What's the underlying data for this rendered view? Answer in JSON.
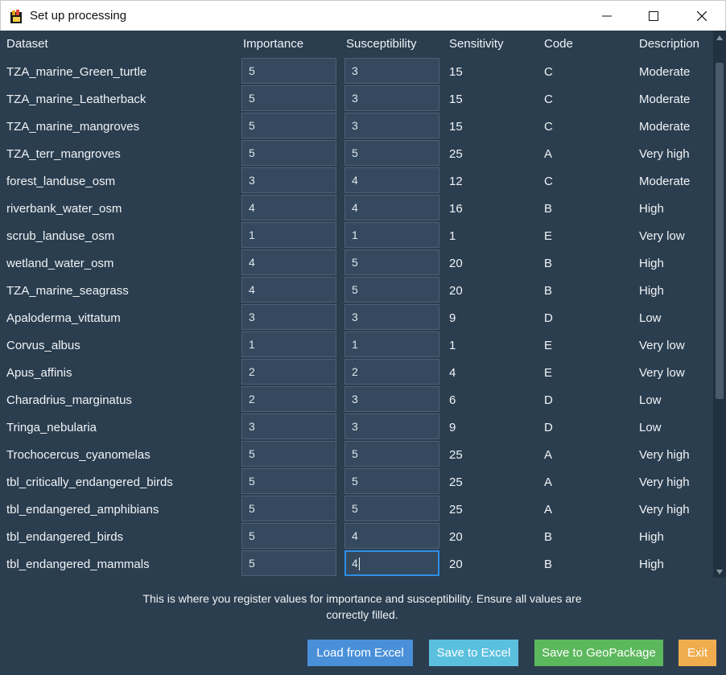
{
  "window": {
    "title": "Set up processing"
  },
  "headers": {
    "dataset": "Dataset",
    "importance": "Importance",
    "susceptibility": "Susceptibility",
    "sensitivity": "Sensitivity",
    "code": "Code",
    "description": "Description"
  },
  "rows": [
    {
      "dataset": "TZA_marine_Green_turtle",
      "importance": "5",
      "susceptibility": "3",
      "sensitivity": "15",
      "code": "C",
      "description": "Moderate"
    },
    {
      "dataset": "TZA_marine_Leatherback",
      "importance": "5",
      "susceptibility": "3",
      "sensitivity": "15",
      "code": "C",
      "description": "Moderate"
    },
    {
      "dataset": "TZA_marine_mangroves",
      "importance": "5",
      "susceptibility": "3",
      "sensitivity": "15",
      "code": "C",
      "description": "Moderate"
    },
    {
      "dataset": "TZA_terr_mangroves",
      "importance": "5",
      "susceptibility": "5",
      "sensitivity": "25",
      "code": "A",
      "description": "Very high"
    },
    {
      "dataset": "forest_landuse_osm",
      "importance": "3",
      "susceptibility": "4",
      "sensitivity": "12",
      "code": "C",
      "description": "Moderate"
    },
    {
      "dataset": "riverbank_water_osm",
      "importance": "4",
      "susceptibility": "4",
      "sensitivity": "16",
      "code": "B",
      "description": "High"
    },
    {
      "dataset": "scrub_landuse_osm",
      "importance": "1",
      "susceptibility": "1",
      "sensitivity": "1",
      "code": "E",
      "description": "Very low"
    },
    {
      "dataset": "wetland_water_osm",
      "importance": "4",
      "susceptibility": "5",
      "sensitivity": "20",
      "code": "B",
      "description": "High"
    },
    {
      "dataset": "TZA_marine_seagrass",
      "importance": "4",
      "susceptibility": "5",
      "sensitivity": "20",
      "code": "B",
      "description": "High"
    },
    {
      "dataset": "Apaloderma_vittatum",
      "importance": "3",
      "susceptibility": "3",
      "sensitivity": "9",
      "code": "D",
      "description": "Low"
    },
    {
      "dataset": "Corvus_albus",
      "importance": "1",
      "susceptibility": "1",
      "sensitivity": "1",
      "code": "E",
      "description": "Very low"
    },
    {
      "dataset": "Apus_affinis",
      "importance": "2",
      "susceptibility": "2",
      "sensitivity": "4",
      "code": "E",
      "description": "Very low"
    },
    {
      "dataset": "Charadrius_marginatus",
      "importance": "2",
      "susceptibility": "3",
      "sensitivity": "6",
      "code": "D",
      "description": "Low"
    },
    {
      "dataset": "Tringa_nebularia",
      "importance": "3",
      "susceptibility": "3",
      "sensitivity": "9",
      "code": "D",
      "description": "Low"
    },
    {
      "dataset": "Trochocercus_cyanomelas",
      "importance": "5",
      "susceptibility": "5",
      "sensitivity": "25",
      "code": "A",
      "description": "Very high"
    },
    {
      "dataset": "tbl_critically_endangered_birds",
      "importance": "5",
      "susceptibility": "5",
      "sensitivity": "25",
      "code": "A",
      "description": "Very high"
    },
    {
      "dataset": "tbl_endangered_amphibians",
      "importance": "5",
      "susceptibility": "5",
      "sensitivity": "25",
      "code": "A",
      "description": "Very high"
    },
    {
      "dataset": "tbl_endangered_birds",
      "importance": "5",
      "susceptibility": "4",
      "sensitivity": "20",
      "code": "B",
      "description": "High"
    },
    {
      "dataset": "tbl_endangered_mammals",
      "importance": "5",
      "susceptibility": "4",
      "sensitivity": "20",
      "code": "B",
      "description": "High"
    }
  ],
  "info_text": "This is where you register values for importance and susceptibility. Ensure all values are correctly filled.",
  "buttons": {
    "load_excel": "Load from Excel",
    "save_excel": "Save to Excel",
    "save_geopackage": "Save to GeoPackage",
    "exit": "Exit"
  },
  "colors": {
    "background": "#2b3e50",
    "input_bg": "#34495e",
    "focus_border": "#2f8fe8",
    "load_excel": "#4a90d9",
    "save_excel": "#5bc0de",
    "save_geopackage": "#5cb85c",
    "exit": "#f0ad4e"
  },
  "icons": {
    "app": "app-icon",
    "minimize": "minimize-icon",
    "maximize": "maximize-icon",
    "close": "close-icon"
  }
}
